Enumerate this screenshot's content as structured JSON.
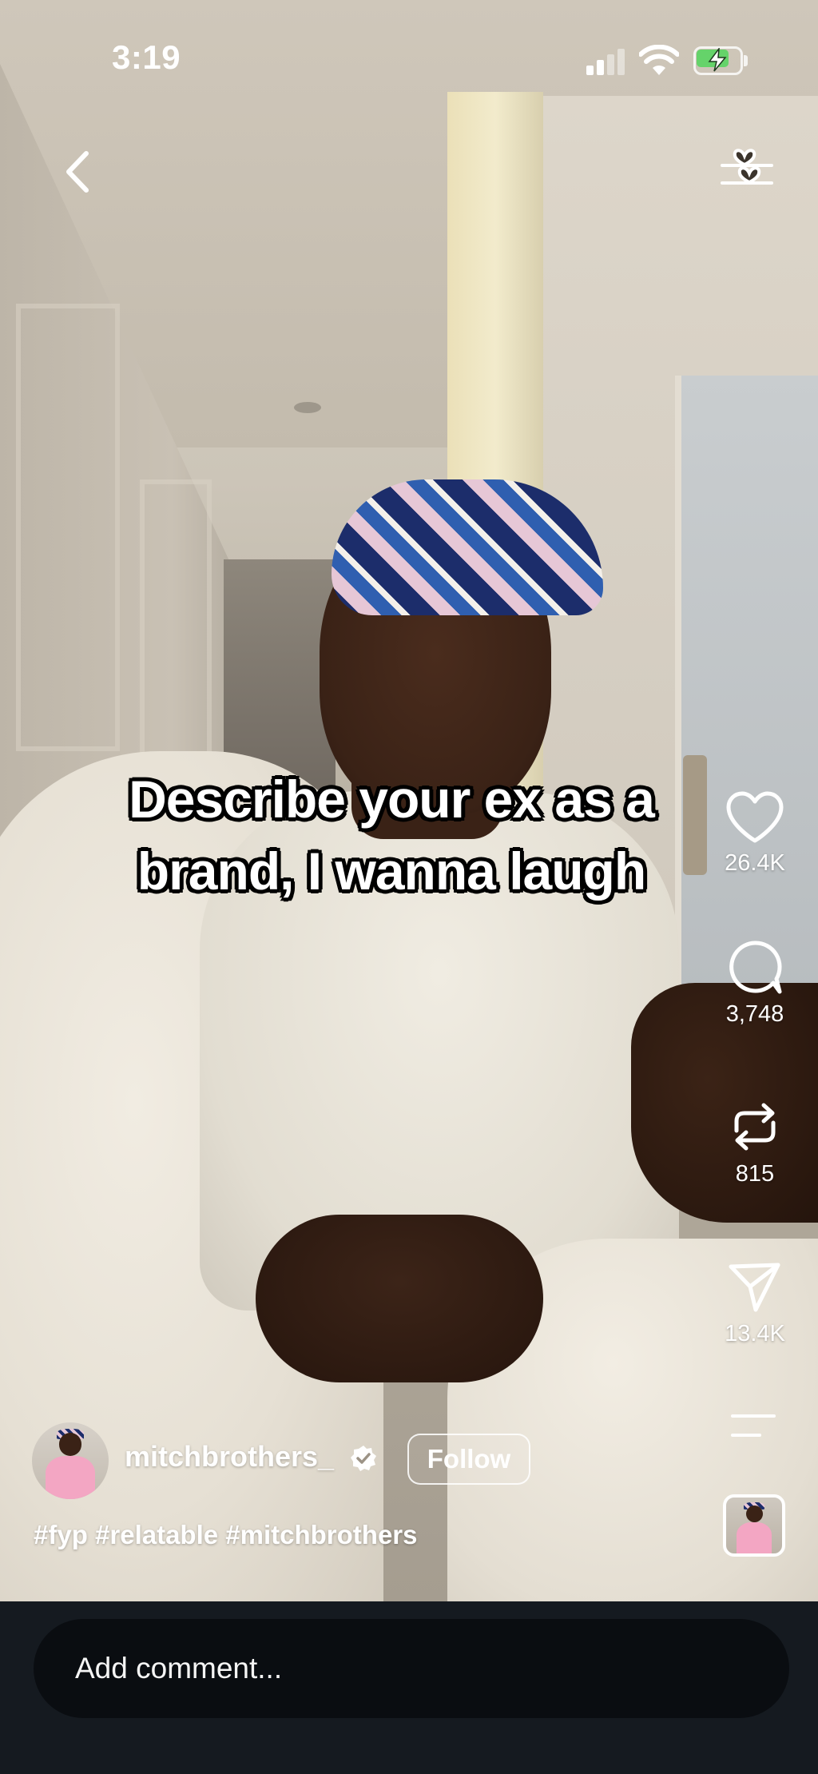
{
  "status_bar": {
    "time": "3:19",
    "battery_color": "#65d36a"
  },
  "top_nav": {
    "back_icon": "chevron-left-icon",
    "filter_icon": "heart-sliders-icon"
  },
  "video": {
    "caption": "Describe your ex as a brand, I wanna laugh"
  },
  "actions": {
    "like": {
      "icon": "heart-icon",
      "count": "26.4K"
    },
    "comment": {
      "icon": "speech-bubble-icon",
      "count": "3,748"
    },
    "repost": {
      "icon": "repost-icon",
      "count": "815"
    },
    "share": {
      "icon": "paper-plane-icon",
      "count": "13.4K"
    },
    "more": {
      "icon": "menu-lines-icon"
    }
  },
  "author": {
    "username": "mitchbrothers_",
    "verified": true,
    "follow_label": "Follow"
  },
  "post": {
    "hashtags": "#fyp #relatable #mitchbrothers"
  },
  "comment_bar": {
    "placeholder": "Add comment..."
  }
}
